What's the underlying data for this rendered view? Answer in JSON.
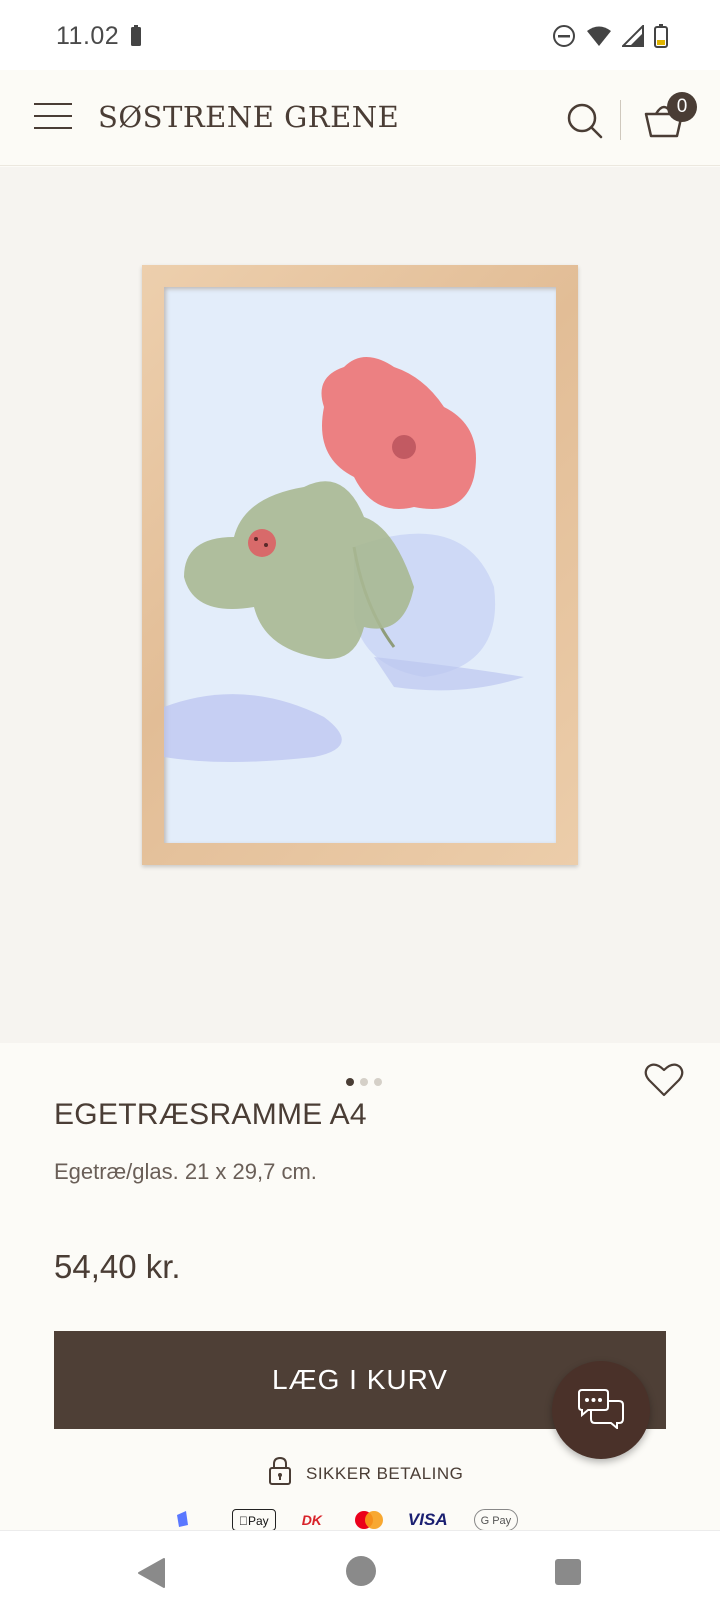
{
  "status_bar": {
    "time": "11.02"
  },
  "header": {
    "brand": "SØSTRENE GRENE",
    "cart_count": "0"
  },
  "gallery": {
    "image_count": 3,
    "active_index": 0
  },
  "product": {
    "title": "EGETRÆSRAMME A4",
    "description": "Egetræ/glas. 21 x 29,7 cm.",
    "price": "54,40 kr.",
    "add_to_cart_label": "LÆG I KURV",
    "secure_payment_label": "SIKKER BETALING"
  },
  "payments": {
    "applepay": "Pay",
    "dankort": "DK",
    "visa": "VISA",
    "gpay": "G Pay"
  },
  "colors": {
    "brand_brown": "#4e3f36",
    "background": "#fcfbf7",
    "image_bg": "#f6f4f0"
  }
}
